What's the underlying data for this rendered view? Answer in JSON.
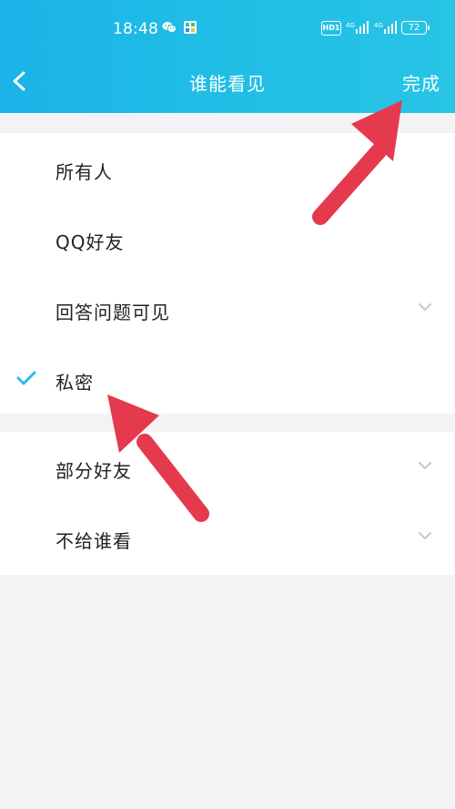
{
  "status_bar": {
    "time": "18:48",
    "network_badge": "HD1",
    "battery_level": "72"
  },
  "navbar": {
    "title": "谁能看见",
    "done_label": "完成"
  },
  "options": [
    {
      "label": "所有人",
      "selected": false,
      "expandable": false
    },
    {
      "label": "QQ好友",
      "selected": false,
      "expandable": false
    },
    {
      "label": "回答问题可见",
      "selected": false,
      "expandable": true
    },
    {
      "label": "私密",
      "selected": true,
      "expandable": false
    },
    {
      "label": "部分好友",
      "selected": false,
      "expandable": true
    },
    {
      "label": "不给谁看",
      "selected": false,
      "expandable": true
    }
  ],
  "colors": {
    "accent": "#22bde6",
    "background": "#f2f3f5",
    "arrow": "#e5394d",
    "check": "#2bbde6"
  },
  "icons": {
    "back": "back-arrow-icon",
    "check": "checkmark-icon",
    "chevron": "chevron-down-icon"
  }
}
